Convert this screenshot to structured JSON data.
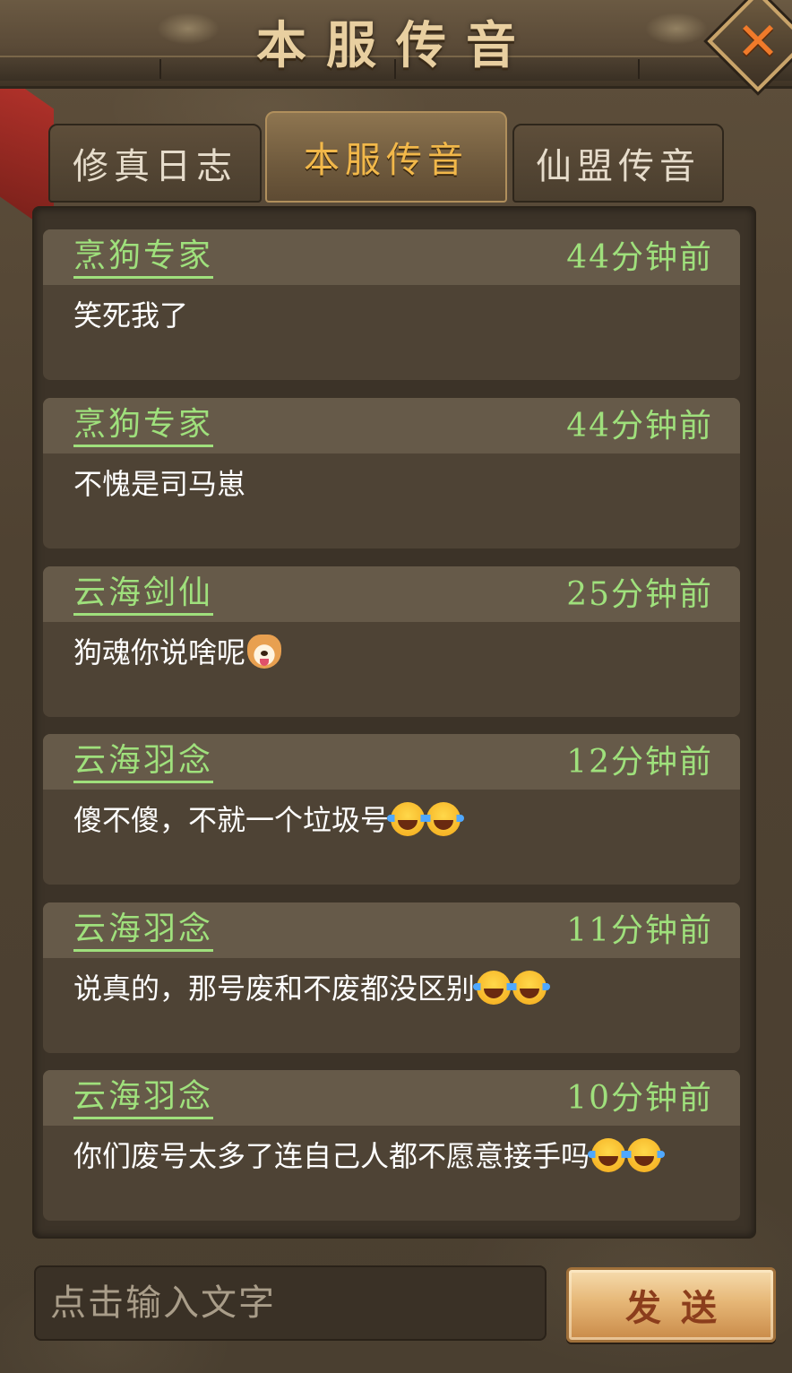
{
  "window": {
    "title": "本服传音",
    "close_icon": "close-x-icon"
  },
  "tabs": [
    {
      "label": "修真日志",
      "active": false
    },
    {
      "label": "本服传音",
      "active": true
    },
    {
      "label": "仙盟传音",
      "active": false
    }
  ],
  "messages": [
    {
      "name": "烹狗专家",
      "time": "44分钟前",
      "text": "笑死我了",
      "emojis": []
    },
    {
      "name": "烹狗专家",
      "time": "44分钟前",
      "text": "不愧是司马崽",
      "emojis": []
    },
    {
      "name": "云海剑仙",
      "time": "25分钟前",
      "text": "狗魂你说啥呢",
      "emojis": [
        "dog-face"
      ]
    },
    {
      "name": "云海羽念",
      "time": "12分钟前",
      "text": "傻不傻，不就一个垃圾号",
      "emojis": [
        "laughing-tears",
        "laughing-tears"
      ]
    },
    {
      "name": "云海羽念",
      "time": "11分钟前",
      "text": "说真的，那号废和不废都没区别",
      "emojis": [
        "laughing-tears",
        "laughing-tears"
      ]
    },
    {
      "name": "云海羽念",
      "time": "10分钟前",
      "text": "你们废号太多了连自己人都不愿意接手吗",
      "emojis": [
        "laughing-tears",
        "laughing-tears"
      ]
    }
  ],
  "composer": {
    "placeholder": "点击输入文字",
    "send_label": "发送"
  },
  "colors": {
    "name_green": "#9fe07c",
    "active_tab_text": "#f2b84a",
    "close_orange": "#f07a2a"
  }
}
